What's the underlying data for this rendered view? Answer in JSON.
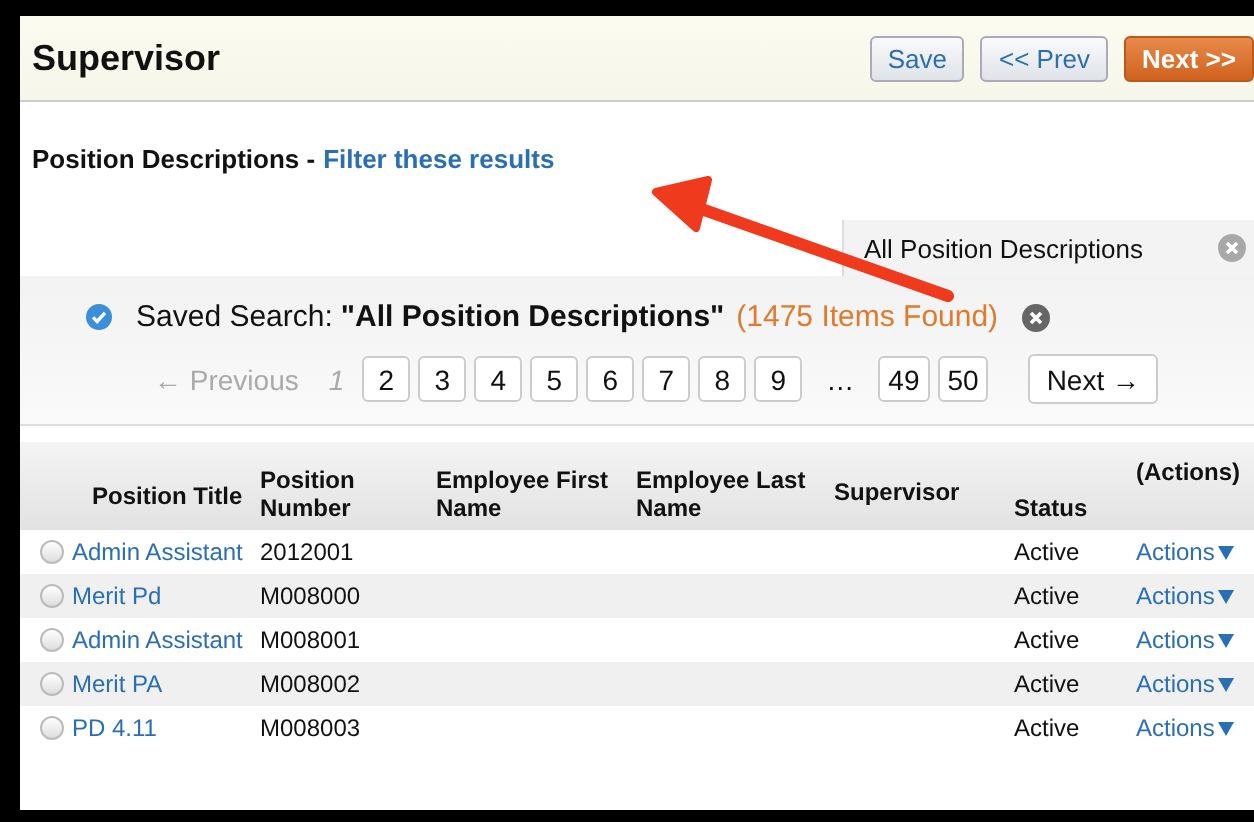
{
  "header": {
    "title": "Supervisor",
    "buttons": [
      {
        "label": "Save",
        "kind": "default"
      },
      {
        "label": "<< Prev",
        "kind": "default"
      },
      {
        "label": "Next >>",
        "kind": "primary"
      }
    ]
  },
  "filter": {
    "label": "Position Descriptions -",
    "link": "Filter these results"
  },
  "saved_tab": {
    "label": "All Position Descriptions"
  },
  "saved_search": {
    "checked": true,
    "prefix": "Saved Search:",
    "name": "\"All Position Descriptions\"",
    "count": "(1475 Items Found)"
  },
  "pagination": {
    "previous": "← Previous",
    "pages": [
      {
        "label": "1",
        "kind": "page",
        "selected": true
      },
      {
        "label": "2",
        "kind": "page",
        "selected": false
      },
      {
        "label": "3",
        "kind": "page",
        "selected": false
      },
      {
        "label": "4",
        "kind": "page",
        "selected": false
      },
      {
        "label": "5",
        "kind": "page",
        "selected": false
      },
      {
        "label": "6",
        "kind": "page",
        "selected": false
      },
      {
        "label": "7",
        "kind": "page",
        "selected": false
      },
      {
        "label": "8",
        "kind": "page",
        "selected": false
      },
      {
        "label": "9",
        "kind": "page",
        "selected": false
      },
      {
        "label": "…",
        "kind": "ellipsis"
      },
      {
        "label": "49",
        "kind": "page",
        "selected": false
      },
      {
        "label": "50",
        "kind": "page",
        "selected": false
      }
    ],
    "next": "Next →"
  },
  "table": {
    "columns": [
      "Position Title",
      "Position Number",
      "Employee First Name",
      "Employee Last Name",
      "Supervisor",
      "Status",
      "(Actions)"
    ],
    "rows": [
      {
        "title": "Admin Assistant",
        "number": "2012001",
        "status": "Active",
        "action": "Actions",
        "selected": false
      },
      {
        "title": "Merit Pd",
        "number": "M008000",
        "status": "Active",
        "action": "Actions",
        "selected": false
      },
      {
        "title": "Admin Assistant",
        "number": "M008001",
        "status": "Active",
        "action": "Actions",
        "selected": false
      },
      {
        "title": "Merit PA",
        "number": "M008002",
        "status": "Active",
        "action": "Actions",
        "selected": false
      },
      {
        "title": "PD 4.11",
        "number": "M008003",
        "status": "Active",
        "action": "Actions",
        "selected": false
      }
    ]
  }
}
